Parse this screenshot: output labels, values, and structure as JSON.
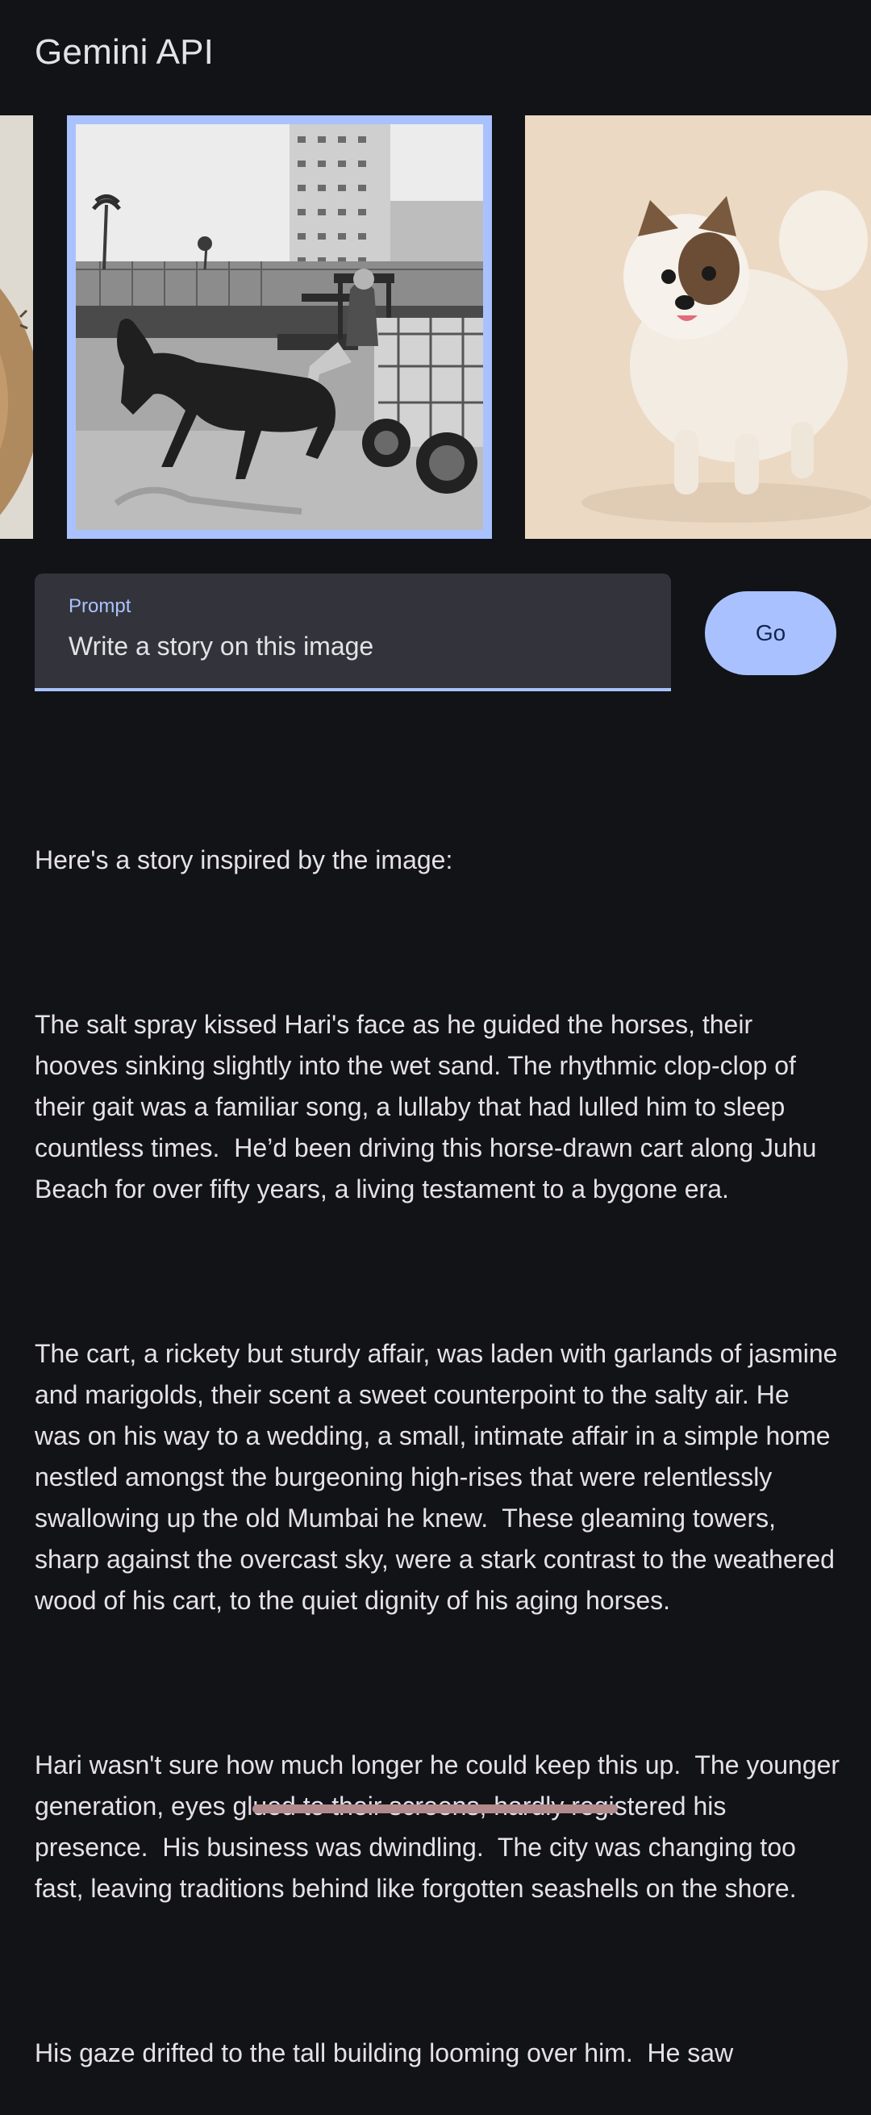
{
  "app": {
    "title": "Gemini API"
  },
  "carousel": {
    "images": [
      {
        "name": "partial-image-left",
        "selected": false
      },
      {
        "name": "horse-cart-beach-photo",
        "selected": true
      },
      {
        "name": "pomeranian-dog-photo",
        "selected": false
      }
    ],
    "selection_color": "#a9c2ff"
  },
  "prompt": {
    "label": "Prompt",
    "value": "Write a story on this image"
  },
  "go_button": {
    "label": "Go"
  },
  "response": {
    "paragraphs": [
      "Here's a story inspired by the image:",
      "The salt spray kissed Hari's face as he guided the horses, their hooves sinking slightly into the wet sand. The rhythmic clop-clop of their gait was a familiar song, a lullaby that had lulled him to sleep countless times.  He’d been driving this horse-drawn cart along Juhu Beach for over fifty years, a living testament to a bygone era.",
      "The cart, a rickety but sturdy affair, was laden with garlands of jasmine and marigolds, their scent a sweet counterpoint to the salty air. He was on his way to a wedding, a small, intimate affair in a simple home nestled amongst the burgeoning high-rises that were relentlessly swallowing up the old Mumbai he knew.  These gleaming towers, sharp against the overcast sky, were a stark contrast to the weathered wood of his cart, to the quiet dignity of his aging horses.",
      "Hari wasn't sure how much longer he could keep this up.  The younger generation, eyes glued to their screens, hardly registered his presence.  His business was dwindling.  The city was changing too fast, leaving traditions behind like forgotten seashells on the shore.",
      "His gaze drifted to the tall building looming over him.  He saw"
    ]
  },
  "colors": {
    "background": "#121317",
    "accent": "#a9c2ff",
    "field_background": "#33343b"
  }
}
